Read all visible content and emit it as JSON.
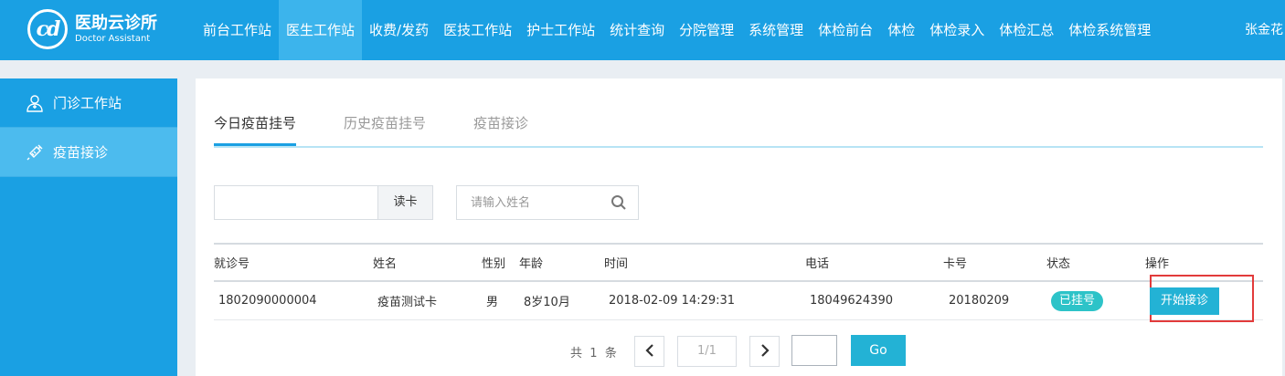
{
  "app": {
    "logo_cn": "医助云诊所",
    "logo_en": "Doctor Assistant",
    "logo_mark": "cd",
    "user_name": "张金花"
  },
  "nav": [
    {
      "label": "前台工作站",
      "active": false
    },
    {
      "label": "医生工作站",
      "active": true
    },
    {
      "label": "收费/发药",
      "active": false
    },
    {
      "label": "医技工作站",
      "active": false
    },
    {
      "label": "护士工作站",
      "active": false
    },
    {
      "label": "统计查询",
      "active": false
    },
    {
      "label": "分院管理",
      "active": false
    },
    {
      "label": "系统管理",
      "active": false
    },
    {
      "label": "体检前台",
      "active": false
    },
    {
      "label": "体检",
      "active": false
    },
    {
      "label": "体检录入",
      "active": false
    },
    {
      "label": "体检汇总",
      "active": false
    },
    {
      "label": "体检系统管理",
      "active": false
    }
  ],
  "sidebar": {
    "items": [
      {
        "label": "门诊工作站",
        "icon": "user-icon",
        "active": false
      },
      {
        "label": "疫苗接诊",
        "icon": "syringe-icon",
        "active": true
      }
    ]
  },
  "tabs": [
    {
      "label": "今日疫苗挂号",
      "active": true
    },
    {
      "label": "历史疫苗挂号",
      "active": false
    },
    {
      "label": "疫苗接诊",
      "active": false
    }
  ],
  "search": {
    "card_value": "",
    "read_card_label": "读卡",
    "name_placeholder": "请输入姓名"
  },
  "table": {
    "headers": [
      "就诊号",
      "姓名",
      "性别",
      "年龄",
      "时间",
      "电话",
      "卡号",
      "状态",
      "操作"
    ],
    "rows": [
      {
        "visit_no": "1802090000004",
        "name": "疫苗测试卡",
        "gender": "男",
        "age": "8岁10月",
        "time": "2018-02-09 14:29:31",
        "phone": "18049624390",
        "card_no": "20180209",
        "status": "已挂号",
        "action": "开始接诊"
      }
    ]
  },
  "pager": {
    "total_prefix": "共",
    "total": "1",
    "total_suffix": "条",
    "current": "1/1",
    "jump_value": "",
    "go_label": "Go"
  },
  "colors": {
    "primary": "#1aa0e3",
    "active_nav": "#3cb4ec",
    "button": "#23b2d5",
    "status_badge": "#2dc3c8",
    "highlight_frame": "#e23b3b"
  }
}
